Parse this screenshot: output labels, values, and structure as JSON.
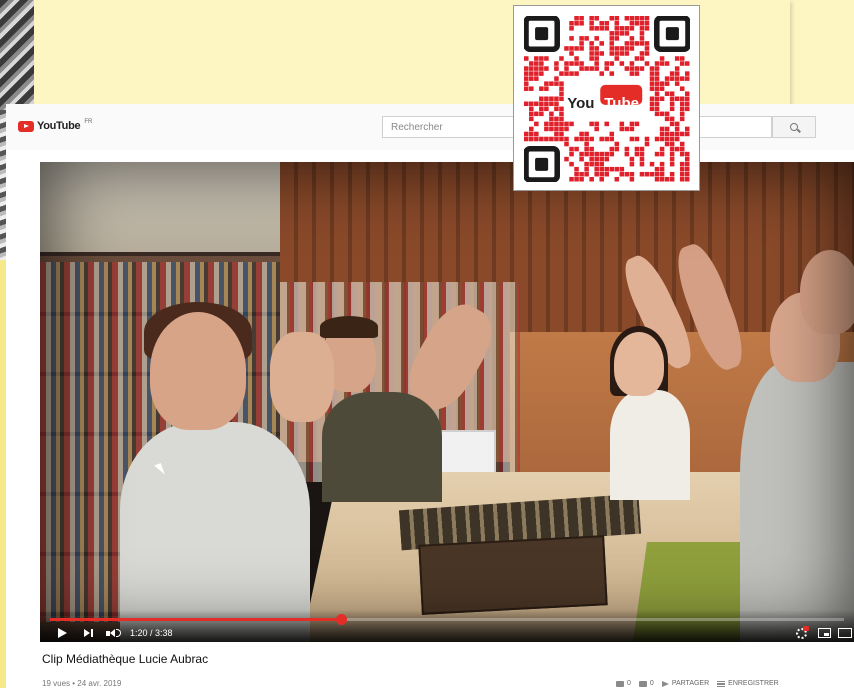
{
  "youtube": {
    "logo_text": "YouTube",
    "logo_region": "FR",
    "search_placeholder": "Rechercher"
  },
  "player": {
    "time": "1:20 / 3:38",
    "progress": 0.367
  },
  "video": {
    "title": "Clip Médiathèque Lucie Aubrac",
    "meta": "19 vues • 24 avr. 2019"
  },
  "actions": {
    "likes": "0",
    "dislikes": "0",
    "share_label": "PARTAGER",
    "save_label": "ENREGISTRER"
  },
  "qr": {
    "badge_text": "YouTube",
    "badge_you": "You",
    "badge_tube": "Tube",
    "color": "#e0202a"
  },
  "colors": {
    "accent_red": "#e52d27",
    "background_yellow": "#fdf6c3"
  }
}
